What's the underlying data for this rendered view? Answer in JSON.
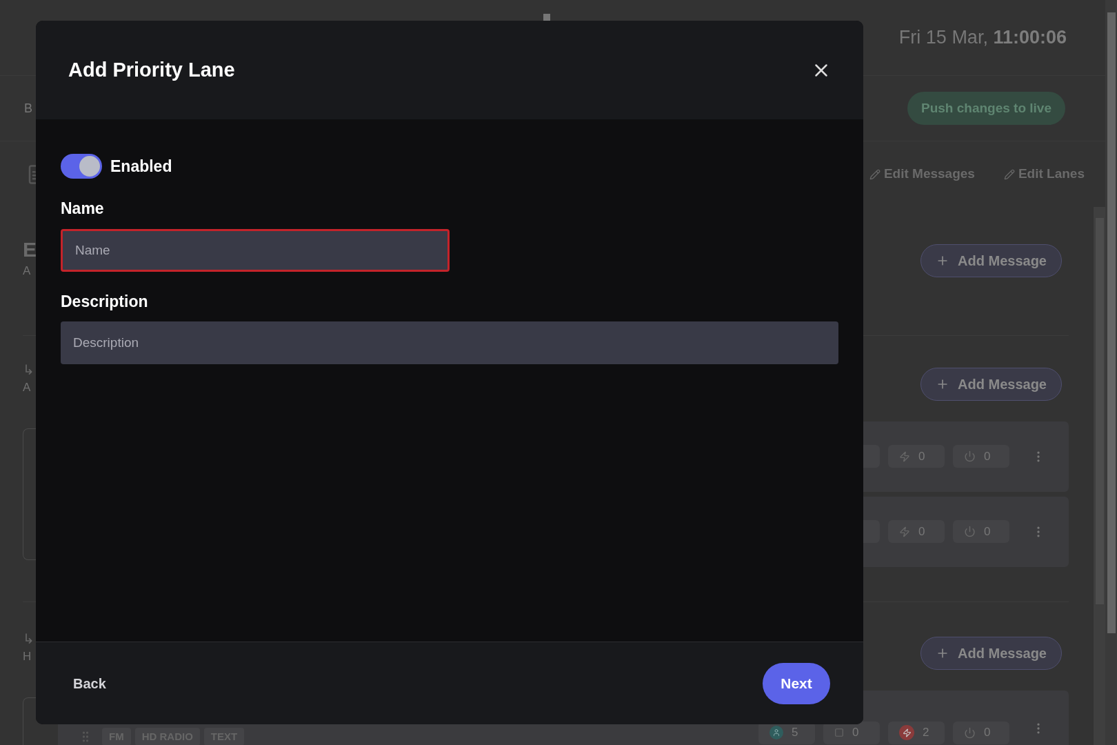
{
  "header": {
    "date": "Fri 15 Mar,",
    "time": "11:00:06"
  },
  "toolbar": {
    "peek": "B",
    "push_label": "Push changes to live"
  },
  "actions": [
    {
      "label": "Edit Messages"
    },
    {
      "label": "Edit Lanes"
    }
  ],
  "sections": [
    {
      "title": "E",
      "subtitle": "A",
      "add_label": "Add Message"
    },
    {
      "marker": "↳",
      "subtitle": "A",
      "add_label": "Add Message",
      "cards": [
        {
          "chips": [
            {
              "kind": "blank"
            },
            {
              "kind": "bolt",
              "value": "0",
              "alert": false
            },
            {
              "kind": "power",
              "value": "0"
            }
          ]
        },
        {
          "chips": [
            {
              "kind": "blank"
            },
            {
              "kind": "bolt",
              "value": "0",
              "alert": false
            },
            {
              "kind": "power",
              "value": "0"
            }
          ]
        }
      ]
    },
    {
      "marker": "↳",
      "subtitle": "H",
      "add_label": "Add Message",
      "cards": [
        {
          "tags": [
            "FM",
            "HD RADIO",
            "TEXT"
          ],
          "chips": [
            {
              "kind": "person",
              "value": "5"
            },
            {
              "kind": "square",
              "value": "0"
            },
            {
              "kind": "bolt",
              "value": "2",
              "alert": true
            },
            {
              "kind": "power",
              "value": "0"
            }
          ]
        }
      ]
    }
  ],
  "dialog": {
    "title": "Add Priority Lane",
    "toggle": {
      "label": "Enabled",
      "on": true
    },
    "fields": [
      {
        "label": "Name",
        "placeholder": "Name",
        "error": true,
        "wide": false
      },
      {
        "label": "Description",
        "placeholder": "Description",
        "error": false,
        "wide": true
      }
    ],
    "back": "Back",
    "next": "Next"
  }
}
